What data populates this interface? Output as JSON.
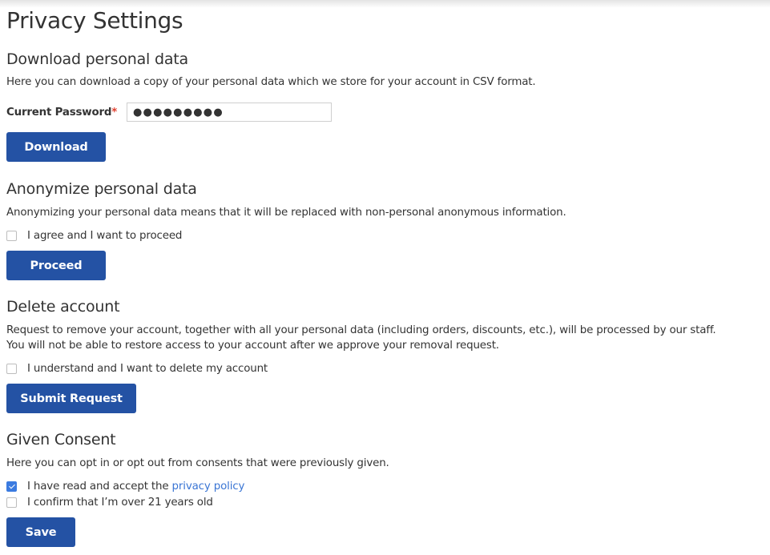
{
  "page": {
    "title": "Privacy Settings"
  },
  "download": {
    "heading": "Download personal data",
    "description": "Here you can download a copy of your personal data which we store for your account in CSV format.",
    "password_label": "Current Password",
    "required_mark": "*",
    "password_value": "●●●●●●●●●",
    "button_label": "Download"
  },
  "anonymize": {
    "heading": "Anonymize personal data",
    "description": "Anonymizing your personal data means that it will be replaced with non-personal anonymous information.",
    "checkbox_label": "I agree and I want to proceed",
    "checkbox_checked": false,
    "button_label": "Proceed"
  },
  "delete": {
    "heading": "Delete account",
    "description_line1": "Request to remove your account, together with all your personal data (including orders, discounts, etc.), will be processed by our staff.",
    "description_line2": "You will not be able to restore access to your account after we approve your removal request.",
    "checkbox_label": "I understand and I want to delete my account",
    "checkbox_checked": false,
    "button_label": "Submit Request"
  },
  "consent": {
    "heading": "Given Consent",
    "description": "Here you can opt in or opt out from consents that were previously given.",
    "items": [
      {
        "label_prefix": "I have read and accept the ",
        "link_text": "privacy policy",
        "checked": true
      },
      {
        "label": "I confirm that I’m over 21 years old",
        "checked": false
      }
    ],
    "button_label": "Save"
  },
  "colors": {
    "primary_button": "#2452a4",
    "link": "#3a75d4",
    "required": "#e0402f",
    "checkbox_checked": "#3b7be0"
  }
}
